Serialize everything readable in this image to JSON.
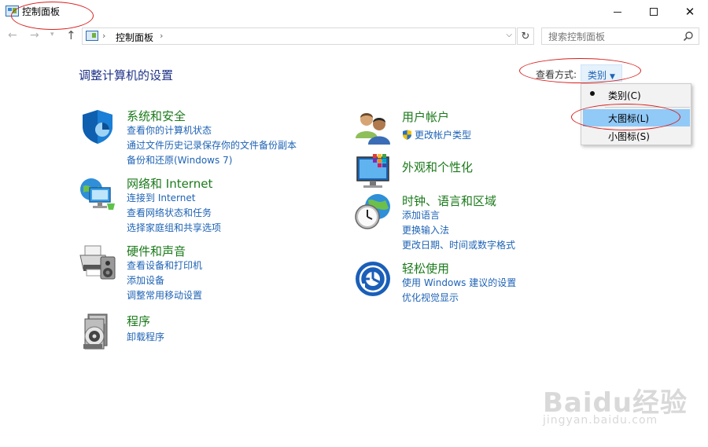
{
  "window": {
    "title": "控制面板"
  },
  "nav": {
    "back_icon": "back-arrow-icon",
    "forward_icon": "forward-arrow-icon",
    "up_icon": "up-arrow-icon"
  },
  "address": {
    "path": "控制面板",
    "separator": "›"
  },
  "search": {
    "placeholder": "搜索控制面板"
  },
  "page": {
    "title": "调整计算机的设置"
  },
  "view": {
    "label": "查看方式:",
    "value": "类别",
    "options": [
      {
        "label": "类别(C)",
        "checked": true
      },
      {
        "label": "大图标(L)",
        "highlighted": true
      },
      {
        "label": "小图标(S)"
      }
    ]
  },
  "categories_left": [
    {
      "title": "系统和安全",
      "icon": "shield-icon",
      "links": [
        "查看你的计算机状态",
        "通过文件历史记录保存你的文件备份副本",
        "备份和还原(Windows 7)"
      ]
    },
    {
      "title": "网络和 Internet",
      "icon": "network-globe-icon",
      "links": [
        "连接到 Internet",
        "查看网络状态和任务",
        "选择家庭组和共享选项"
      ]
    },
    {
      "title": "硬件和声音",
      "icon": "printer-speaker-icon",
      "links": [
        "查看设备和打印机",
        "添加设备",
        "调整常用移动设置"
      ]
    },
    {
      "title": "程序",
      "icon": "programs-disc-icon",
      "links": [
        "卸载程序"
      ]
    }
  ],
  "categories_right": [
    {
      "title": "用户帐户",
      "icon": "users-icon",
      "links": [
        "更改帐户类型"
      ]
    },
    {
      "title": "外观和个性化",
      "icon": "monitor-palette-icon",
      "links": []
    },
    {
      "title": "时钟、语言和区域",
      "icon": "clock-globe-icon",
      "links": [
        "添加语言",
        "更换输入法",
        "更改日期、时间或数字格式"
      ]
    },
    {
      "title": "轻松使用",
      "icon": "ease-of-access-icon",
      "links": [
        "使用 Windows 建议的设置",
        "优化视觉显示"
      ]
    }
  ],
  "watermark": {
    "text": "Baidu经验",
    "sub": "jingyan.baidu.com"
  },
  "colors": {
    "link": "#1e63b5",
    "category_title": "#1b7a1b",
    "page_title": "#1e3287",
    "menu_highlight": "#91c9f7",
    "annotation": "#d81e1e"
  }
}
